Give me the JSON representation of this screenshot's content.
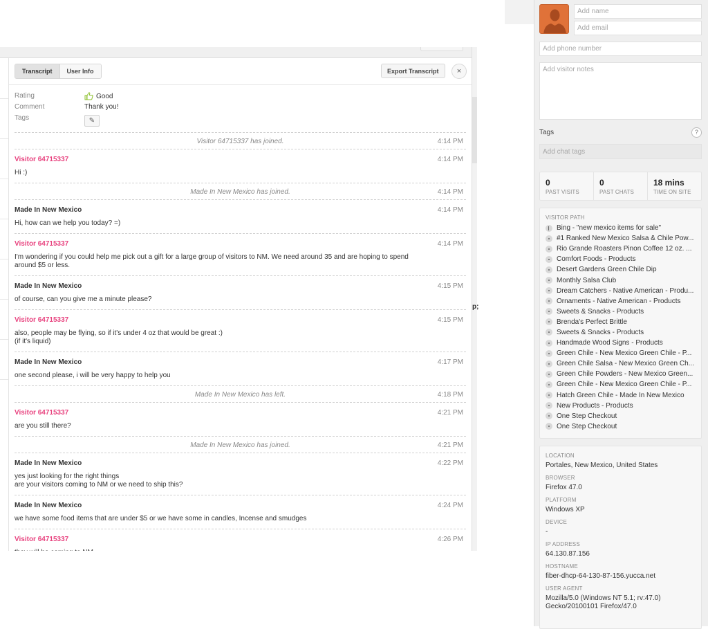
{
  "modal": {
    "tabs": [
      {
        "label": "Transcript",
        "active": true
      },
      {
        "label": "User Info",
        "active": false
      }
    ],
    "export_label": "Export Transcript",
    "close_glyph": "×"
  },
  "meta": {
    "rating_label": "Rating",
    "rating_value": "Good",
    "comment_label": "Comment",
    "comment_value": "Thank you!",
    "tags_label": "Tags",
    "edit_glyph": "✎"
  },
  "transcript": [
    {
      "type": "event",
      "text": "Visitor 64715337 has joined.",
      "time": "4:14 PM"
    },
    {
      "type": "msg",
      "role": "visitor",
      "sender": "Visitor 64715337",
      "time": "4:14 PM",
      "body": "Hi :)"
    },
    {
      "type": "event",
      "text": "Made In New Mexico has joined.",
      "time": "4:14 PM"
    },
    {
      "type": "msg",
      "role": "agent",
      "sender": "Made In New Mexico",
      "time": "4:14 PM",
      "body": "Hi, how can we help you today? =)"
    },
    {
      "type": "msg",
      "role": "visitor",
      "sender": "Visitor 64715337",
      "time": "4:14 PM",
      "body": "I'm wondering if you could help me pick out a gift for a large group of visitors to NM. We need around 35 and are hoping to spend around $5 or less."
    },
    {
      "type": "msg",
      "role": "agent",
      "sender": "Made In New Mexico",
      "time": "4:15 PM",
      "body": "of course, can you give me a minute please?"
    },
    {
      "type": "msg",
      "role": "visitor",
      "sender": "Visitor 64715337",
      "time": "4:15 PM",
      "body": "also, people may be flying, so if it's under 4 oz that would be great :)\n(if it's liquid)"
    },
    {
      "type": "msg",
      "role": "agent",
      "sender": "Made In New Mexico",
      "time": "4:17 PM",
      "body": "one second please, i will be very happy to help you"
    },
    {
      "type": "event",
      "text": "Made In New Mexico has left.",
      "time": "4:18 PM"
    },
    {
      "type": "msg",
      "role": "visitor",
      "sender": "Visitor 64715337",
      "time": "4:21 PM",
      "body": "are you still there?"
    },
    {
      "type": "event",
      "text": "Made In New Mexico has joined.",
      "time": "4:21 PM"
    },
    {
      "type": "msg",
      "role": "agent",
      "sender": "Made In New Mexico",
      "time": "4:22 PM",
      "body": "yes just looking for the right things\nare your visitors coming to NM or we need to ship this?"
    },
    {
      "type": "msg",
      "role": "agent",
      "sender": "Made In New Mexico",
      "time": "4:24 PM",
      "body": "we have some food items that are under $5 or we have some in candles, Incense and smudges"
    },
    {
      "type": "msg",
      "role": "visitor",
      "sender": "Visitor 64715337",
      "time": "4:26 PM",
      "body": "they will be coming to NM"
    }
  ],
  "background": {
    "fragment_text": "p;"
  },
  "panel": {
    "name_placeholder": "Add name",
    "email_placeholder": "Add email",
    "phone_placeholder": "Add phone number",
    "notes_placeholder": "Add visitor notes",
    "tags_label": "Tags",
    "help_glyph": "?",
    "chat_tags_placeholder": "Add chat tags",
    "stats": [
      {
        "value": "0",
        "label": "PAST VISITS"
      },
      {
        "value": "0",
        "label": "PAST CHATS"
      },
      {
        "value": "18 mins",
        "label": "TIME ON SITE"
      }
    ],
    "visitor_path_title": "VISITOR PATH",
    "visitor_path": [
      {
        "label": "Bing - \"new mexico items for sale\"",
        "icon": "referrer-arrow"
      },
      {
        "label": "#1 Ranked New Mexico Salsa & Chile Pow...",
        "icon": "page-dot"
      },
      {
        "label": "Rio Grande Roasters Pinon Coffee 12 oz. ...",
        "icon": "page-dot"
      },
      {
        "label": "Comfort Foods - Products",
        "icon": "page-dot"
      },
      {
        "label": "Desert Gardens Green Chile Dip",
        "icon": "page-dot"
      },
      {
        "label": "Monthly Salsa Club",
        "icon": "page-dot"
      },
      {
        "label": "Dream Catchers - Native American - Produ...",
        "icon": "page-dot"
      },
      {
        "label": "Ornaments - Native American - Products",
        "icon": "page-dot"
      },
      {
        "label": "Sweets & Snacks - Products",
        "icon": "page-dot"
      },
      {
        "label": "Brenda's Perfect Brittle",
        "icon": "page-dot"
      },
      {
        "label": "Sweets & Snacks - Products",
        "icon": "page-dot"
      },
      {
        "label": "Handmade Wood Signs - Products",
        "icon": "page-dot"
      },
      {
        "label": "Green Chile - New Mexico Green Chile - P...",
        "icon": "page-dot"
      },
      {
        "label": "Green Chile Salsa - New Mexico Green Ch...",
        "icon": "page-dot"
      },
      {
        "label": "Green Chile Powders - New Mexico Green...",
        "icon": "page-dot"
      },
      {
        "label": "Green Chile - New Mexico Green Chile - P...",
        "icon": "page-dot"
      },
      {
        "label": "Hatch Green Chile - Made In New Mexico",
        "icon": "page-dot"
      },
      {
        "label": "New Products - Products",
        "icon": "page-dot"
      },
      {
        "label": "One Step Checkout",
        "icon": "page-dot"
      },
      {
        "label": "One Step Checkout",
        "icon": "page-dot"
      }
    ],
    "info": [
      {
        "label": "LOCATION",
        "value": "Portales, New Mexico, United States"
      },
      {
        "label": "BROWSER",
        "value": "Firefox 47.0"
      },
      {
        "label": "PLATFORM",
        "value": "Windows XP"
      },
      {
        "label": "DEVICE",
        "value": "-"
      },
      {
        "label": "IP ADDRESS",
        "value": "64.130.87.156"
      },
      {
        "label": "HOSTNAME",
        "value": "fiber-dhcp-64-130-87-156.yucca.net"
      },
      {
        "label": "USER AGENT",
        "value": "Mozilla/5.0 (Windows NT 5.1; rv:47.0) Gecko/20100101 Firefox/47.0"
      }
    ]
  },
  "colors": {
    "visitor_name": "#e8437f",
    "agent_name": "#333333",
    "avatar_bg": "#e07239",
    "rating_good": "#8bbf2a"
  }
}
